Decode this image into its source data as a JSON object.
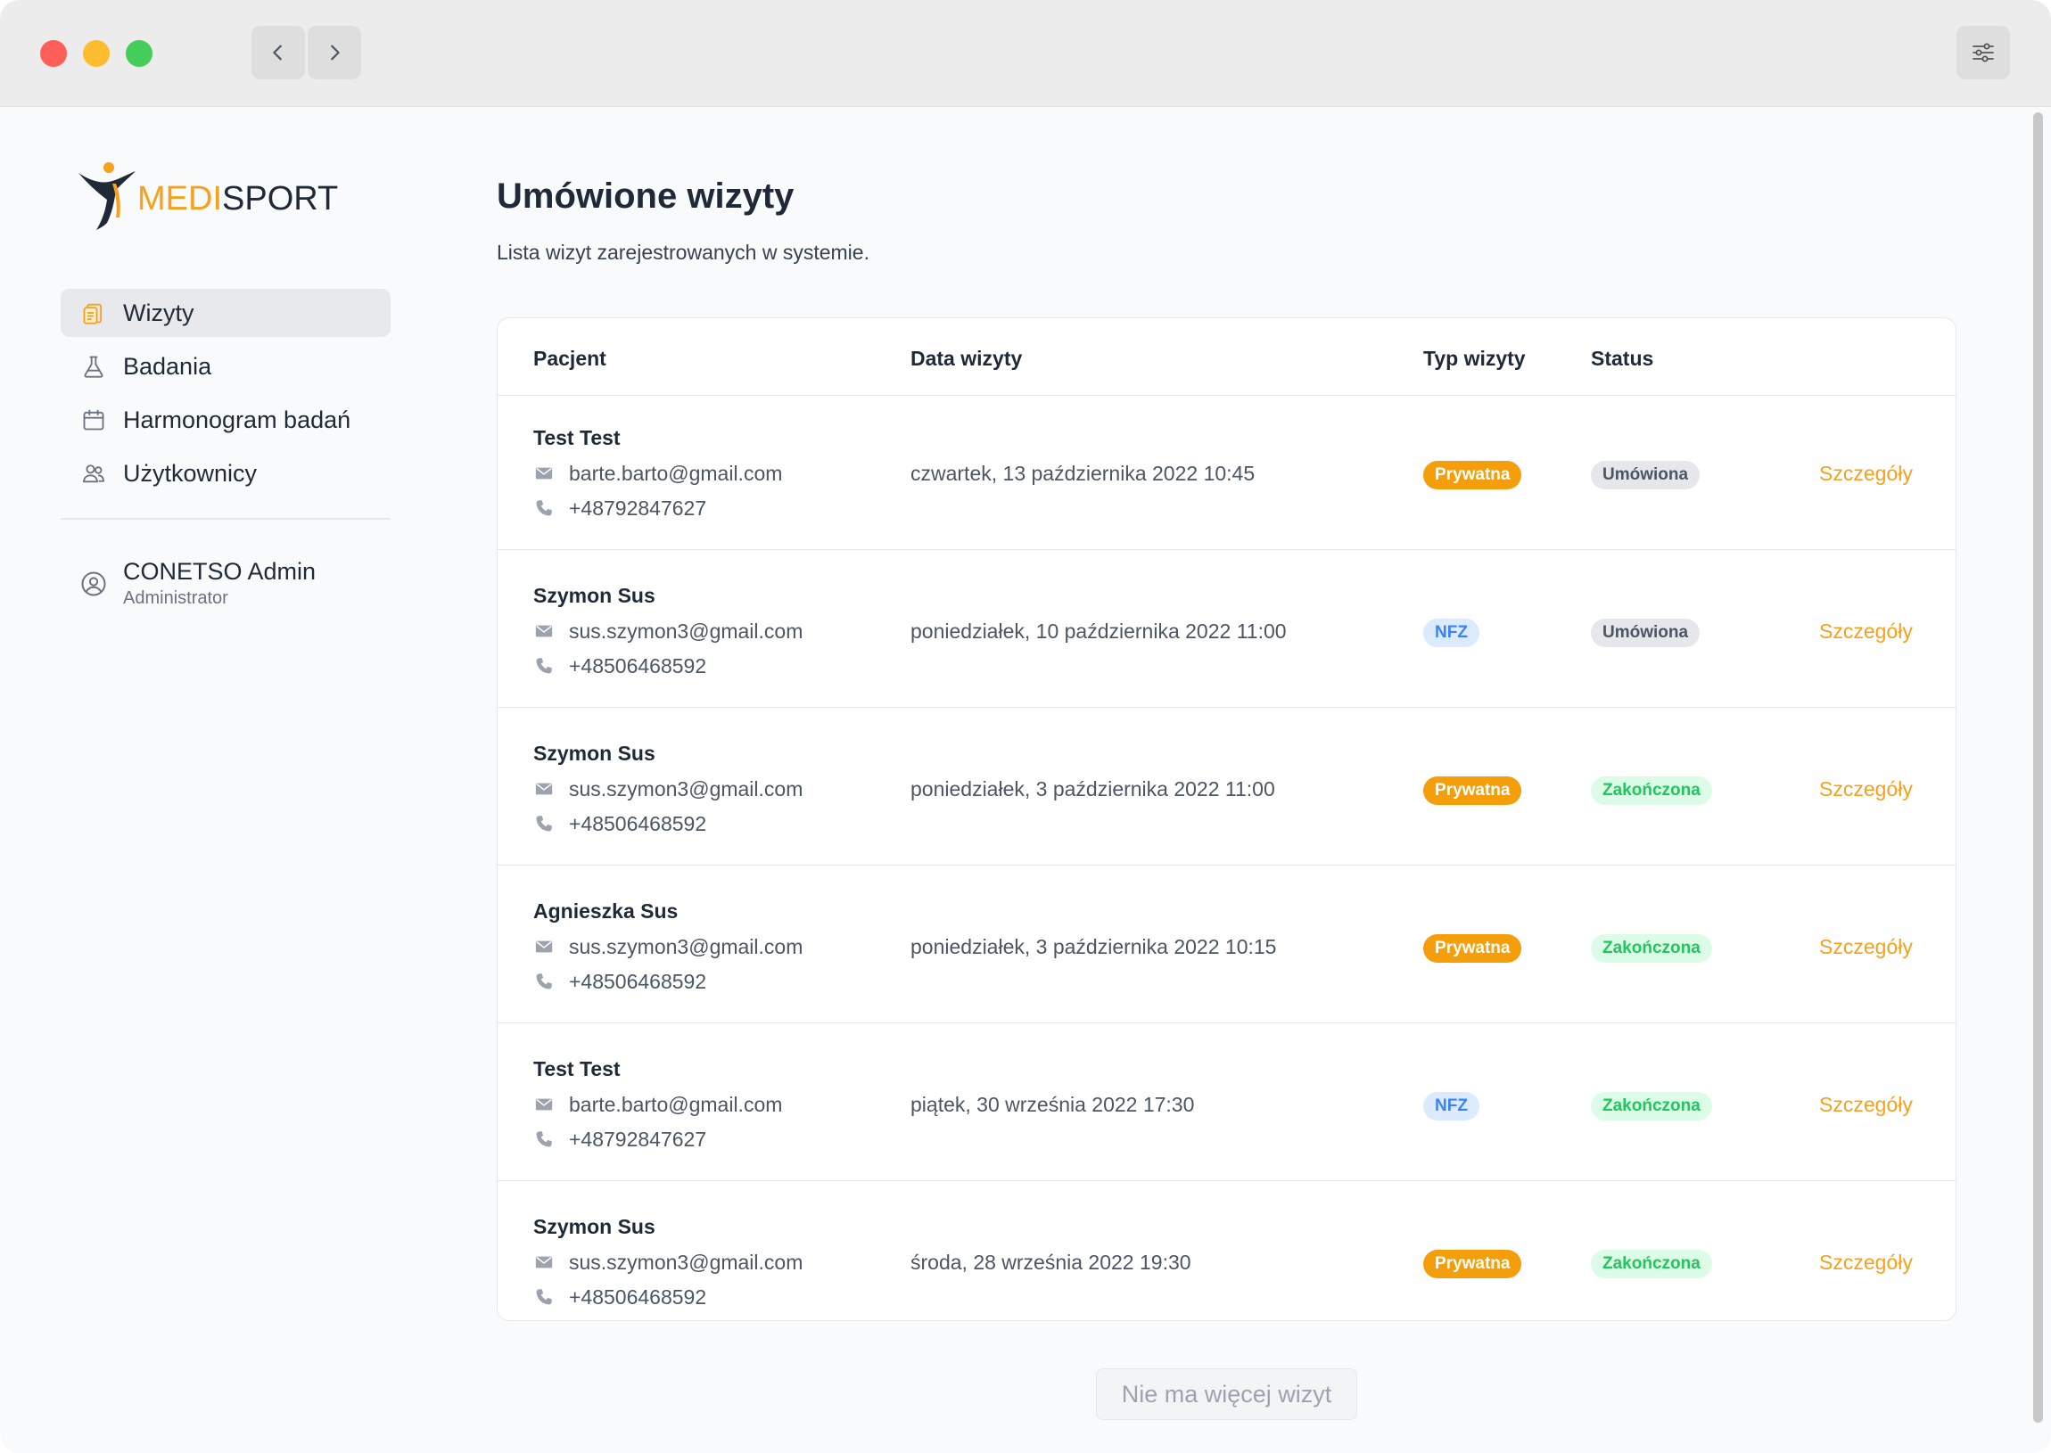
{
  "brand": {
    "part1": "MEDI",
    "part2": "SPORT"
  },
  "sidebar": {
    "items": [
      {
        "label": "Wizyty",
        "icon": "clipboard-icon",
        "active": true
      },
      {
        "label": "Badania",
        "icon": "flask-icon",
        "active": false
      },
      {
        "label": "Harmonogram badań",
        "icon": "calendar-icon",
        "active": false
      },
      {
        "label": "Użytkownicy",
        "icon": "users-icon",
        "active": false
      }
    ],
    "user": {
      "name": "CONETSO Admin",
      "role": "Administrator",
      "icon": "user-circle-icon"
    }
  },
  "main": {
    "title": "Umówione wizyty",
    "subtitle": "Lista wizyt zarejestrowanych w systemie.",
    "table": {
      "headers": {
        "patient": "Pacjent",
        "date": "Data wizyty",
        "type": "Typ wizyty",
        "status": "Status"
      },
      "rows": [
        {
          "name": "Test Test",
          "email": "barte.barto@gmail.com",
          "phone": "+48792847627",
          "date": "czwartek, 13 października 2022 10:45",
          "type": "Prywatna",
          "status": "Umówiona",
          "details": "Szczegóły"
        },
        {
          "name": "Szymon Sus",
          "email": "sus.szymon3@gmail.com",
          "phone": "+48506468592",
          "date": "poniedziałek, 10 października 2022 11:00",
          "type": "NFZ",
          "status": "Umówiona",
          "details": "Szczegóły"
        },
        {
          "name": "Szymon Sus",
          "email": "sus.szymon3@gmail.com",
          "phone": "+48506468592",
          "date": "poniedziałek, 3 października 2022 11:00",
          "type": "Prywatna",
          "status": "Zakończona",
          "details": "Szczegóły"
        },
        {
          "name": "Agnieszka Sus",
          "email": "sus.szymon3@gmail.com",
          "phone": "+48506468592",
          "date": "poniedziałek, 3 października 2022 10:15",
          "type": "Prywatna",
          "status": "Zakończona",
          "details": "Szczegóły"
        },
        {
          "name": "Test Test",
          "email": "barte.barto@gmail.com",
          "phone": "+48792847627",
          "date": "piątek, 30 września 2022 17:30",
          "type": "NFZ",
          "status": "Zakończona",
          "details": "Szczegóły"
        },
        {
          "name": "Szymon Sus",
          "email": "sus.szymon3@gmail.com",
          "phone": "+48506468592",
          "date": "środa, 28 września 2022 19:30",
          "type": "Prywatna",
          "status": "Zakończona",
          "details": "Szczegóły"
        }
      ]
    },
    "more_button": "Nie ma więcej wizyt"
  },
  "colors": {
    "accent": "#f5a11c",
    "badge_private": "#f59e0b",
    "badge_nfz": "#dbeafe",
    "badge_scheduled": "#e5e7eb",
    "badge_completed": "#dcfce7"
  }
}
